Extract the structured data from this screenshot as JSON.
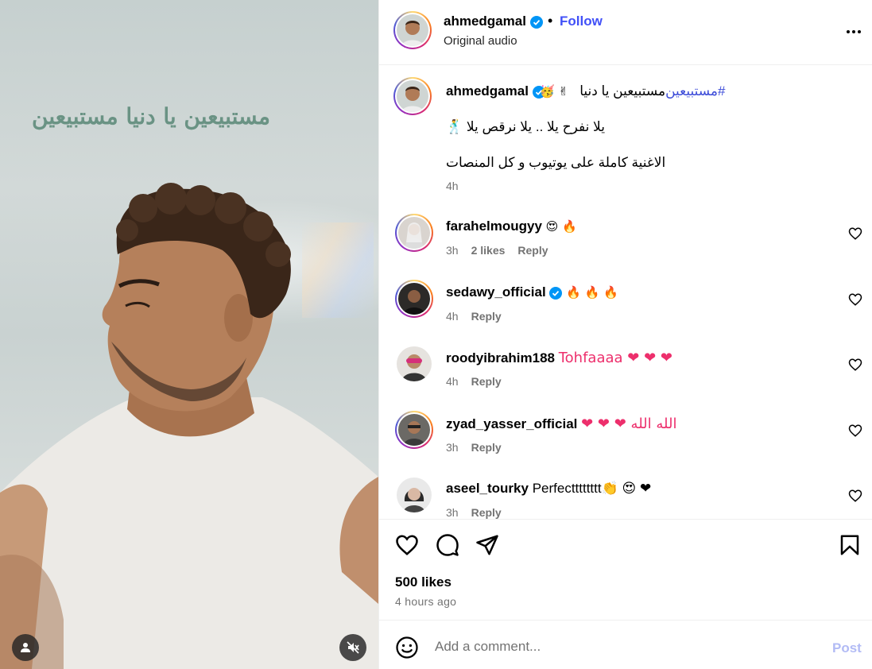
{
  "media": {
    "overlay_text": "مستبيعين يا دنيا مستبيعين",
    "user_tag_icon": "person-icon",
    "mute_icon": "speaker-muted-icon"
  },
  "header": {
    "username": "ahmedgamal",
    "separator": "•",
    "follow_label": "Follow",
    "audio_label": "Original audio"
  },
  "caption": {
    "username": "ahmedgamal",
    "emoji": "🥳 ✌",
    "text_plain": "مستبيعين يا دنيا ",
    "hashtag": "#مستبيعين",
    "line2": "يلا نفرح يلا .. يلا نرقص يلا 🕺",
    "line3": "الاغنية كاملة على يوتيوب و كل المنصات",
    "time": "4h"
  },
  "comments": [
    {
      "username": "farahelmougyy",
      "verified": false,
      "text": "😍 🔥",
      "time": "3h",
      "likes": "2 likes",
      "reply": "Reply"
    },
    {
      "username": "sedawy_official",
      "verified": true,
      "text": "🔥 🔥 🔥",
      "time": "4h",
      "likes": "",
      "reply": "Reply"
    },
    {
      "username": "roodyibrahim188",
      "verified": false,
      "text": "Tohfaaaa ❤ ❤ ❤",
      "time": "4h",
      "likes": "",
      "reply": "Reply"
    },
    {
      "username": "zyad_yasser_official",
      "verified": false,
      "text": "❤ ❤ ❤  الله الله",
      "time": "3h",
      "likes": "",
      "reply": "Reply"
    },
    {
      "username": "aseel_tourky",
      "verified": false,
      "text": "Perfectttttttt👏 😍 ❤",
      "time": "3h",
      "likes": "",
      "reply": "Reply"
    }
  ],
  "actions": {
    "like_icon": "heart-outline-icon",
    "comment_icon": "comment-bubble-icon",
    "share_icon": "paper-plane-icon",
    "save_icon": "bookmark-icon",
    "likes_count": "500 likes",
    "posted_ago": "4 hours ago"
  },
  "composer": {
    "placeholder": "Add a comment...",
    "post_label": "Post"
  },
  "colors": {
    "follow_blue": "#4150f7",
    "hashtag_blue": "#3c4bd8",
    "verified_blue": "#0095f6",
    "heart_red": "#ed2f6c",
    "post_disabled": "#b2bbf5",
    "overlay_green": "#6a9384"
  }
}
